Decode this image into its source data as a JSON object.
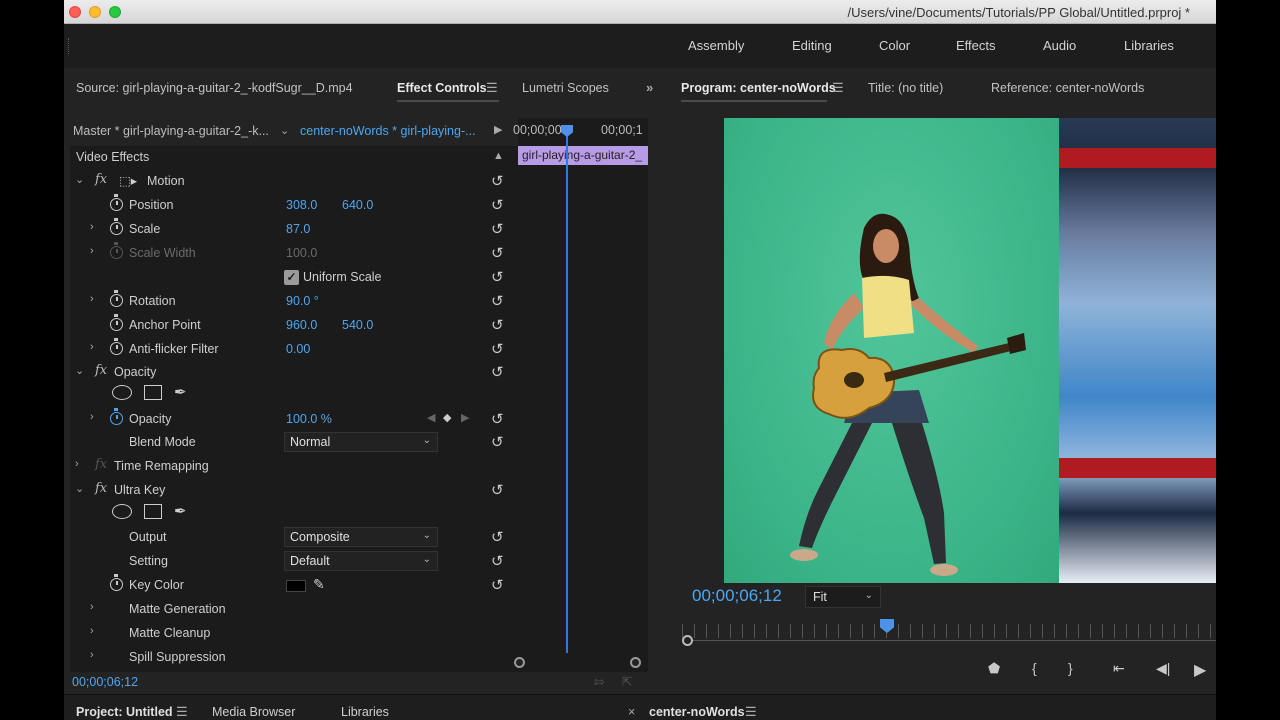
{
  "window": {
    "title": "/Users/vine/Documents/Tutorials/PP Global/Untitled.prproj *"
  },
  "workspaces": [
    "Assembly",
    "Editing",
    "Color",
    "Effects",
    "Audio",
    "Libraries"
  ],
  "left_panel": {
    "tabs": {
      "source": "Source: girl-playing-a-guitar-2_-kodfSugr__D.mp4",
      "effect_controls": "Effect Controls",
      "lumetri_scopes": "Lumetri Scopes"
    },
    "master_label": "Master * girl-playing-a-guitar-2_-k...",
    "sequence_clip_label": "center-noWords * girl-playing-...",
    "timeline_start": "00;00;00",
    "timeline_end": "00;00;1",
    "clip_name": "girl-playing-a-guitar-2_"
  },
  "effects": {
    "section_title": "Video Effects",
    "motion": {
      "name": "Motion",
      "position_label": "Position",
      "position_x": "308.0",
      "position_y": "640.0",
      "scale_label": "Scale",
      "scale": "87.0",
      "scale_width_label": "Scale Width",
      "scale_width": "100.0",
      "uniform_scale_label": "Uniform Scale",
      "rotation_label": "Rotation",
      "rotation": "90.0 °",
      "anchor_label": "Anchor Point",
      "anchor_x": "960.0",
      "anchor_y": "540.0",
      "antiflicker_label": "Anti-flicker Filter",
      "antiflicker": "0.00"
    },
    "opacity": {
      "name": "Opacity",
      "opacity_label": "Opacity",
      "opacity": "100.0 %",
      "blend_label": "Blend Mode",
      "blend": "Normal"
    },
    "time_remapping": {
      "name": "Time Remapping"
    },
    "ultra_key": {
      "name": "Ultra Key",
      "output_label": "Output",
      "output": "Composite",
      "setting_label": "Setting",
      "setting": "Default",
      "key_color_label": "Key Color",
      "key_color": "#000000",
      "matte_generation": "Matte Generation",
      "matte_cleanup": "Matte Cleanup",
      "spill_suppression": "Spill Suppression"
    }
  },
  "left_timecode": "00;00;06;12",
  "program": {
    "tab_program": "Program: center-noWords",
    "tab_title": "Title: (no title)",
    "tab_reference": "Reference: center-noWords",
    "timecode": "00;00;06;12",
    "zoom": "Fit"
  },
  "bottom": {
    "project": "Project: Untitled",
    "media_browser": "Media Browser",
    "libraries": "Libraries",
    "sequence": "center-noWords"
  },
  "colors": {
    "accent_blue": "#4fa6ef",
    "clip_purple": "#b79be6",
    "green_screen": "#3ab488"
  }
}
